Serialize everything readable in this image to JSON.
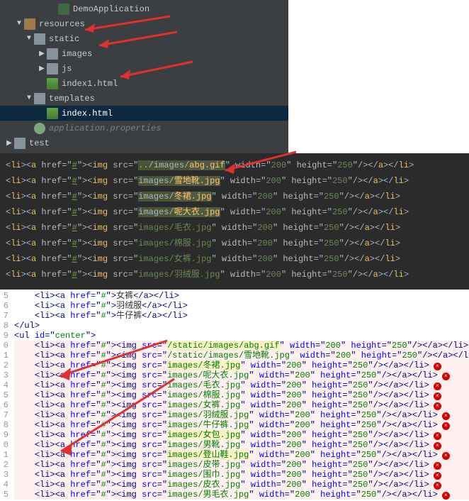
{
  "tree": {
    "items": [
      {
        "indent": 4,
        "expand": "",
        "icon": "run",
        "label": "DemoApplication"
      },
      {
        "indent": 1,
        "expand": "down",
        "icon": "pkg",
        "label": "resources"
      },
      {
        "indent": 2,
        "expand": "down",
        "icon": "folder",
        "label": "static"
      },
      {
        "indent": 3,
        "expand": "right",
        "icon": "folder",
        "label": "images"
      },
      {
        "indent": 3,
        "expand": "right",
        "icon": "folder",
        "label": "js"
      },
      {
        "indent": 3,
        "expand": "",
        "icon": "html",
        "label": "index1.html"
      },
      {
        "indent": 2,
        "expand": "down",
        "icon": "folder",
        "label": "templates"
      },
      {
        "indent": 3,
        "expand": "",
        "icon": "html",
        "label": "index.html",
        "selected": true
      },
      {
        "indent": 2,
        "expand": "",
        "icon": "prop",
        "label": "application.properties",
        "dim": true
      },
      {
        "indent": 0,
        "expand": "right",
        "icon": "folder",
        "label": "test"
      }
    ]
  },
  "dark_editor": {
    "lines": [
      {
        "pathPrefix": "../images/",
        "file": "abg.gif",
        "w": "200",
        "h": "250",
        "hlPath": true
      },
      {
        "pathPrefix": "images/",
        "file": "雪地靴.jpg",
        "w": "200",
        "h": "250",
        "hlPath": true
      },
      {
        "pathPrefix": "images/",
        "file": "冬裙.jpg",
        "w": "200",
        "h": "250",
        "hlPath": true,
        "partial": true
      },
      {
        "pathPrefix": "images/",
        "file": "呢大衣.jpg",
        "w": "200",
        "h": "250",
        "hlPath": true
      },
      {
        "pathPrefix": "images/",
        "file": "毛衣.jpg",
        "w": "200",
        "h": "250"
      },
      {
        "pathPrefix": "images/",
        "file": "棉服.jpg",
        "w": "200",
        "h": "250"
      },
      {
        "pathPrefix": "images/",
        "file": "女裤.jpg",
        "w": "200",
        "h": "250"
      },
      {
        "pathPrefix": "images/",
        "file": "羽绒服.jpg",
        "w": "200",
        "h": "250",
        "cut": true
      }
    ]
  },
  "light_editor": {
    "lead_gutter": [
      "5",
      "6",
      "7",
      "8",
      "9"
    ],
    "lead": [
      {
        "kind": "li-text",
        "text": "女裤"
      },
      {
        "kind": "li-text",
        "text": "羽绒服"
      },
      {
        "kind": "li-text",
        "text": "牛仔裤"
      },
      {
        "kind": "close-ul"
      },
      {
        "kind": "open-ul",
        "id": "center"
      }
    ],
    "err_lines": [
      {
        "g": "0",
        "src": "/static/images/abg.gif",
        "w": "200",
        "h": "250",
        "hl": "src"
      },
      {
        "g": "1",
        "src": "/static/images/雪地靴.jpg",
        "w": "200",
        "h": "250"
      },
      {
        "g": "2",
        "src": "images/冬裙.jpg",
        "w": "200",
        "h": "250",
        "hl": "src"
      },
      {
        "g": "3",
        "src": "images/呢大衣.jpg",
        "w": "200",
        "h": "250"
      },
      {
        "g": "4",
        "src": "images/毛衣.jpg",
        "w": "200",
        "h": "250"
      },
      {
        "g": "5",
        "src": "images/棉服.jpg",
        "w": "200",
        "h": "250"
      },
      {
        "g": "6",
        "src": "images/女裤.jpg",
        "w": "200",
        "h": "250"
      },
      {
        "g": "7",
        "src": "images/羽绒服.jpg",
        "w": "200",
        "h": "250"
      },
      {
        "g": "8",
        "src": "images/牛仔裤.jpg",
        "w": "200",
        "h": "250"
      },
      {
        "g": "9",
        "src": "images/女包.jpg",
        "w": "200",
        "h": "250",
        "hl": "src"
      },
      {
        "g": "0",
        "src": "images/男靴.jpg",
        "w": "200",
        "h": "250"
      },
      {
        "g": "1",
        "src": "images/登山鞋.jpg",
        "w": "200",
        "h": "250",
        "hl": "src"
      },
      {
        "g": "2",
        "src": "images/皮带.jpg",
        "w": "200",
        "h": "250"
      },
      {
        "g": "3",
        "src": "images/围巾.jpg",
        "w": "200",
        "h": "250"
      },
      {
        "g": "4",
        "src": "images/皮衣.jpg",
        "w": "200",
        "h": "250"
      },
      {
        "g": "5",
        "src": "images/男毛衣.jpg",
        "w": "200",
        "h": "250",
        "cut": true
      }
    ]
  },
  "glyph": {
    "down": "▼",
    "right": "▶",
    "none": ""
  }
}
